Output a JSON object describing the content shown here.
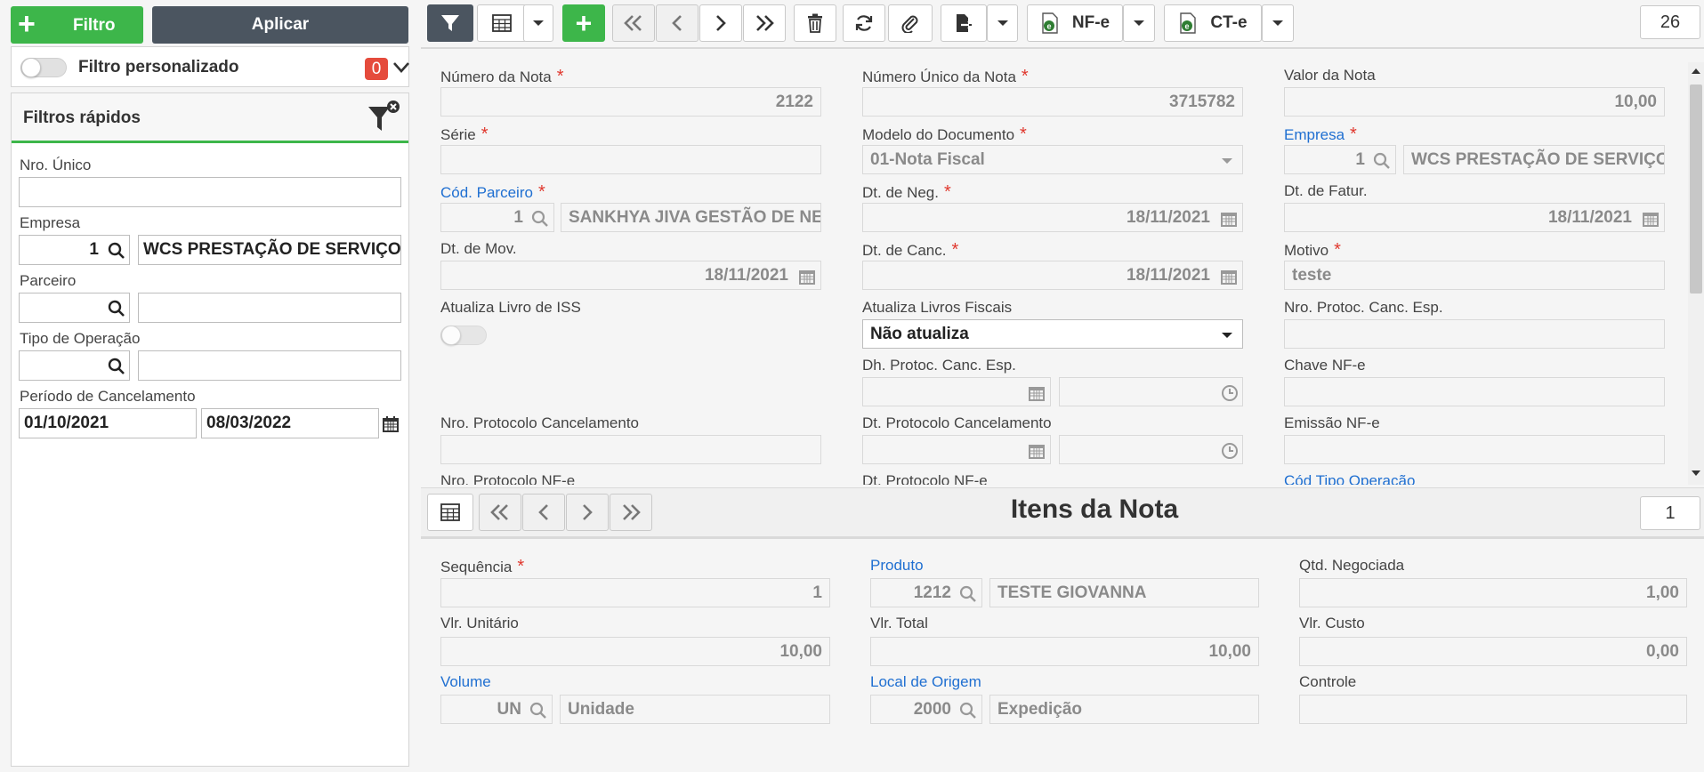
{
  "left": {
    "filter_button": "Filtro",
    "apply_button": "Aplicar",
    "custom_filter_label": "Filtro personalizado",
    "custom_filter_count": "0",
    "quick_filters_title": "Filtros rápidos",
    "nro_unico_label": "Nro. Único",
    "nro_unico_value": "",
    "empresa_label": "Empresa",
    "empresa_code": "1",
    "empresa_name": "WCS PRESTAÇÃO DE SERVIÇOS",
    "parceiro_label": "Parceiro",
    "tipo_operacao_label": "Tipo de Operação",
    "periodo_label": "Período de Cancelamento",
    "periodo_inicio": "01/10/2021",
    "periodo_fim": "08/03/2022"
  },
  "toolbar": {
    "nfe_label": "NF-e",
    "cte_label": "CT-e",
    "record_count": "26"
  },
  "form": {
    "numero_nota": {
      "label": "Número da Nota",
      "value": "2122"
    },
    "numero_unico": {
      "label": "Número Único da Nota",
      "value": "3715782"
    },
    "valor_nota": {
      "label": "Valor da Nota",
      "value": "10,00"
    },
    "serie": {
      "label": "Série",
      "value": ""
    },
    "modelo_documento": {
      "label": "Modelo do Documento",
      "value": "01-Nota Fiscal"
    },
    "empresa": {
      "label": "Empresa",
      "code": "1",
      "name": "WCS PRESTAÇÃO DE SERVIÇOS"
    },
    "cod_parceiro": {
      "label": "Cód. Parceiro",
      "code": "1",
      "name": "SANKHYA JIVA GESTÃO DE NEGÓCIOS"
    },
    "dt_neg": {
      "label": "Dt. de Neg.",
      "value": "18/11/2021"
    },
    "dt_fatur": {
      "label": "Dt. de Fatur.",
      "value": "18/11/2021"
    },
    "dt_mov": {
      "label": "Dt. de Mov.",
      "value": "18/11/2021"
    },
    "dt_canc": {
      "label": "Dt. de Canc.",
      "value": "18/11/2021"
    },
    "motivo": {
      "label": "Motivo",
      "value": "teste"
    },
    "atualiza_iss": {
      "label": "Atualiza Livro de ISS"
    },
    "atualiza_fiscais": {
      "label": "Atualiza Livros Fiscais",
      "value": "Não atualiza"
    },
    "nro_protoc_canc_esp": {
      "label": "Nro. Protoc. Canc. Esp.",
      "value": ""
    },
    "dh_protoc_canc_esp": {
      "label": "Dh. Protoc. Canc. Esp."
    },
    "chave_nfe": {
      "label": "Chave NF-e",
      "value": ""
    },
    "nro_protocolo_canc": {
      "label": "Nro. Protocolo Cancelamento",
      "value": ""
    },
    "dt_protocolo_canc": {
      "label": "Dt. Protocolo Cancelamento"
    },
    "emissao_nfe": {
      "label": "Emissão NF-e",
      "value": ""
    },
    "nro_protocolo_nfe": {
      "label": "Nro. Protocolo NF-e"
    },
    "dt_protocolo_nfe": {
      "label": "Dt. Protocolo NF-e"
    },
    "cod_tipo_operacao": {
      "label": "Cód Tipo Operação"
    }
  },
  "items": {
    "title": "Itens da Nota",
    "record_count": "1",
    "sequencia": {
      "label": "Sequência",
      "value": "1"
    },
    "produto": {
      "label": "Produto",
      "code": "1212",
      "name": "TESTE GIOVANNA"
    },
    "qtd_negociada": {
      "label": "Qtd. Negociada",
      "value": "1,00"
    },
    "vlr_unitario": {
      "label": "Vlr. Unitário",
      "value": "10,00"
    },
    "vlr_total": {
      "label": "Vlr. Total",
      "value": "10,00"
    },
    "vlr_custo": {
      "label": "Vlr. Custo",
      "value": "0,00"
    },
    "volume": {
      "label": "Volume",
      "code": "UN",
      "name": "Unidade"
    },
    "local_origem": {
      "label": "Local de Origem",
      "code": "2000",
      "name": "Expedição"
    },
    "controle": {
      "label": "Controle",
      "value": ""
    }
  }
}
